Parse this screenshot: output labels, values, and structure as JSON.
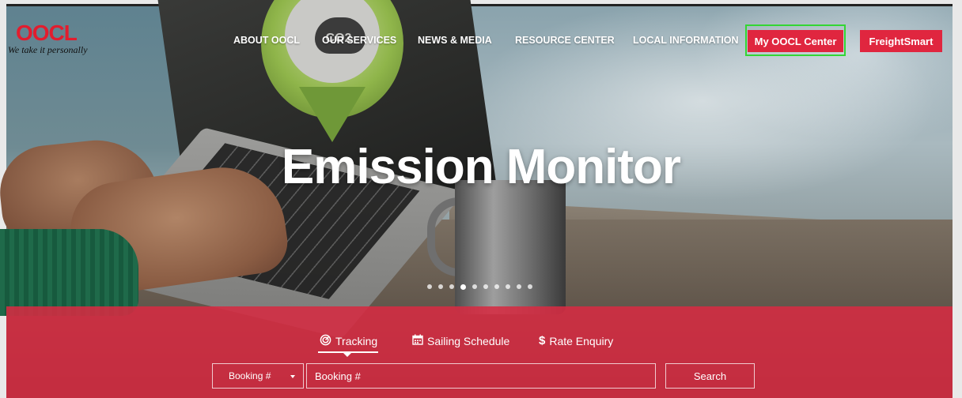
{
  "brand": {
    "logo_text": "OOCL",
    "tagline": "We take it personally",
    "accent": "#e0263f"
  },
  "nav": {
    "items": [
      {
        "label": "ABOUT OOCL"
      },
      {
        "label": "OUR SERVICES"
      },
      {
        "label": "NEWS & MEDIA"
      },
      {
        "label": "RESOURCE CENTER"
      },
      {
        "label": "LOCAL INFORMATION"
      }
    ],
    "my_center_label": "My OOCL Center",
    "freightsmart_label": "FreightSmart",
    "highlight_color": "#33d633"
  },
  "hero": {
    "title": "Emission Monitor",
    "badge_text": "CO2",
    "carousel": {
      "total": 10,
      "active": 4
    }
  },
  "panel": {
    "tabs": [
      {
        "label": "Tracking",
        "icon": "target-icon",
        "active": true
      },
      {
        "label": "Sailing Schedule",
        "icon": "calendar-icon",
        "active": false
      },
      {
        "label": "Rate Enquiry",
        "icon": "dollar-icon",
        "active": false
      }
    ],
    "select_value": "Booking #",
    "input_placeholder": "Booking #",
    "search_label": "Search",
    "panel_color": "#d62b42"
  }
}
